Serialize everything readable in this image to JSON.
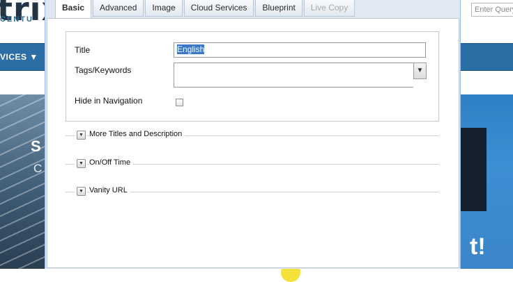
{
  "background": {
    "logo_text": "trix",
    "tagline": "CENTU",
    "search_placeholder": "Enter Query",
    "nav_item": "VICES ▼",
    "hero_letter_1": "S",
    "hero_letter_2": "C",
    "hero_right_text": "t!"
  },
  "dialog": {
    "tabs": [
      {
        "label": "Basic"
      },
      {
        "label": "Advanced"
      },
      {
        "label": "Image"
      },
      {
        "label": "Cloud Services"
      },
      {
        "label": "Blueprint"
      },
      {
        "label": "Live Copy"
      }
    ],
    "form": {
      "title_label": "Title",
      "title_value": "English",
      "tags_label": "Tags/Keywords",
      "tags_value": "",
      "hide_nav_label": "Hide in Navigation",
      "hide_nav_checked": false
    },
    "sections": [
      {
        "label": "More Titles and Description"
      },
      {
        "label": "On/Off Time"
      },
      {
        "label": "Vanity URL"
      }
    ]
  }
}
